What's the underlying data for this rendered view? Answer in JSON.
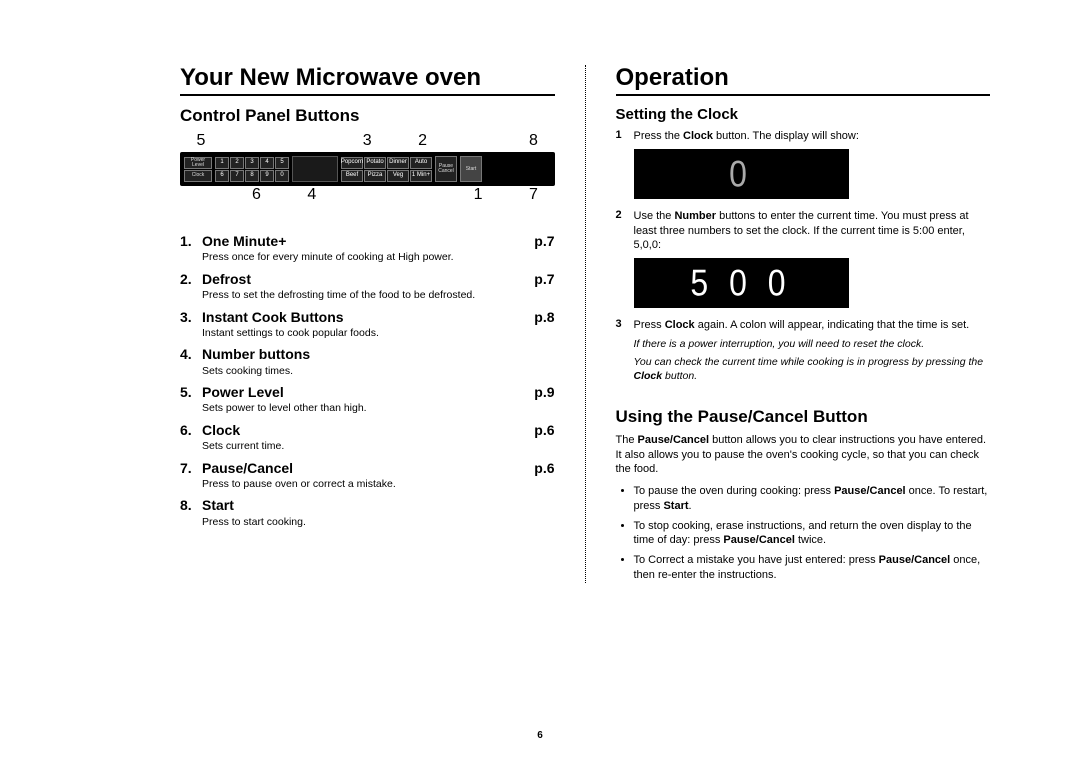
{
  "page_number": "6",
  "left": {
    "title": "Your New Microwave oven",
    "subtitle": "Control Panel Buttons",
    "callouts_top": [
      "5",
      "",
      "",
      "3",
      "2",
      "",
      "8"
    ],
    "callouts_bot": [
      "",
      "6",
      "4",
      "",
      "",
      "1",
      "7"
    ],
    "panel_numbers_row1": [
      "1",
      "2",
      "3",
      "4",
      "5"
    ],
    "panel_numbers_row2": [
      "6",
      "7",
      "8",
      "9",
      "0"
    ],
    "features": [
      {
        "num": "1.",
        "name": "One Minute+",
        "page": "p.7",
        "desc": "Press once for every minute of cooking at High power."
      },
      {
        "num": "2.",
        "name": "Defrost",
        "page": "p.7",
        "desc": "Press to set the defrosting time of the food to be defrosted."
      },
      {
        "num": "3.",
        "name": "Instant Cook Buttons",
        "page": "p.8",
        "desc": "Instant settings to cook popular foods."
      },
      {
        "num": "4.",
        "name": "Number buttons",
        "page": "",
        "desc": "Sets cooking times."
      },
      {
        "num": "5.",
        "name": "Power Level",
        "page": "p.9",
        "desc": "Sets power to level other than high."
      },
      {
        "num": "6.",
        "name": "Clock",
        "page": "p.6",
        "desc": "Sets current time."
      },
      {
        "num": "7.",
        "name": "Pause/Cancel",
        "page": "p.6",
        "desc": "Press to pause oven or correct a mistake."
      },
      {
        "num": "8.",
        "name": "Start",
        "page": "",
        "desc": "Press to start cooking."
      }
    ]
  },
  "right": {
    "title": "Operation",
    "sec1_title": "Setting the Clock",
    "steps": [
      {
        "n": "1",
        "html": "Press the <b>Clock</b> button. The display will show:"
      },
      {
        "n": "2",
        "html": "Use the <b>Number</b> buttons to enter the current time. You must press at least three numbers to set the clock. If the current time is 5:00 enter, 5,0,0:"
      },
      {
        "n": "3",
        "html": "Press <b>Clock</b> again. A colon will appear, indicating that the time is set."
      }
    ],
    "lcd1": "0",
    "lcd2": "5 0 0",
    "note1": "If there is a power interruption, you will need to reset the clock.",
    "note2_html": "You can check the current time while cooking is in progress by pressing the <b>Clock</b> button.",
    "sec2_title": "Using the Pause/Cancel Button",
    "sec2_intro_html": "The <b>Pause/Cancel</b> button allows you to clear instructions you have entered. It also allows you to pause the oven's cooking cycle, so that you can check the food.",
    "bullets": [
      "To pause the oven during cooking: press <b>Pause/Cancel</b> once. To restart, press <b>Start</b>.",
      "To stop cooking, erase instructions, and return the oven display to the time of day: press <b>Pause/Cancel</b> twice.",
      "To Correct a mistake you have just entered: press <b>Pause/Cancel</b> once, then re-enter the instructions."
    ]
  }
}
